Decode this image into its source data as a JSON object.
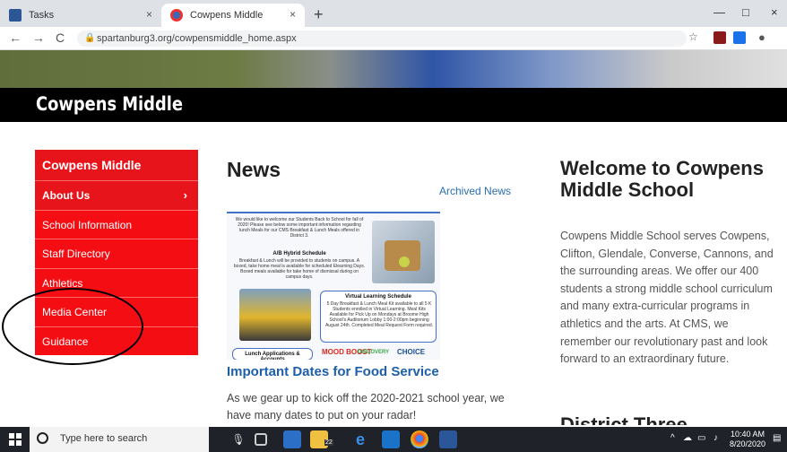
{
  "browser": {
    "tabs": [
      {
        "label": "Tasks",
        "close": "×"
      },
      {
        "label": "Cowpens Middle",
        "close": "×"
      }
    ],
    "new_tab": "+",
    "window_controls": [
      "—",
      "□",
      "×"
    ],
    "nav": {
      "back": "←",
      "forward": "→",
      "reload": "C"
    },
    "url": "spartanburg3.org/cowpensmiddle_home.aspx",
    "lock_icon": "lock-icon"
  },
  "site": {
    "banner_title": "Cowpens Middle",
    "sidebar": {
      "header": "Cowpens Middle",
      "items": [
        {
          "label": "About Us",
          "chevron": "›"
        },
        {
          "label": "School Information"
        },
        {
          "label": "Staff Directory"
        },
        {
          "label": "Athletics"
        },
        {
          "label": "Media Center"
        },
        {
          "label": "Guidance"
        }
      ]
    },
    "news": {
      "title": "News",
      "archived_link": "Archived News",
      "image": {
        "intro": "We would like to welcome our Students Back to School for fall of 2020! Please see below some important information regarding lunch Meals for our CMS Breakfast & Lunch Meals offered in District 3.",
        "ab_title": "A/B Hybrid Schedule",
        "ab_text": "Breakfast & Lunch will be provided to students on campus. A boxed, take home meal is available for scheduled Elearning Days. Boxed meals available for take home of dismissal during on campus days.",
        "virtual_title": "Virtual Learning Schedule",
        "virtual_text": "5 Day Breakfast & Lunch Meal Kit available to all 5 K Students enrolled in Virtual Learning. Meal Kits Available for Pick Up on Mondays at Broome High School's Auditorium Lobby 1:00-2:00pm beginning August 24th. Completed Meal Request Form required.",
        "lunch_apps": "Lunch Applications & Accounts",
        "logos": [
          "MOOD BOOST",
          "DISCOVERY",
          "CHOICE"
        ]
      },
      "headline": "Important Dates for Food Service",
      "body": "As we gear up to kick off the 2020-2021 school year, we have many dates to put on your radar!"
    },
    "welcome": {
      "title": "Welcome to Cowpens Middle School",
      "body": "Cowpens Middle School serves Cowpens, Clifton, Glendale, Converse, Cannons, and the surrounding areas. We offer our 400 students a strong middle school curriculum and many extra-curricular programs in athletics and the arts. At CMS, we remember our revolutionary past and look forward to an extraordinary future.",
      "next_heading": "District Three"
    }
  },
  "taskbar": {
    "search_placeholder": "Type here to search",
    "time": "10:40 AM",
    "date": "8/20/2020",
    "badge": "22"
  },
  "colors": {
    "sidebar_red": "#f40d12",
    "link_blue": "#1d5fa8",
    "banner_black": "#000000"
  }
}
